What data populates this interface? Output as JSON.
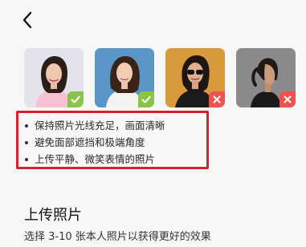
{
  "nav": {
    "back_icon": "chevron-left-icon"
  },
  "samples": [
    {
      "status": "good",
      "icon": "check-icon",
      "color": "#8bc34a"
    },
    {
      "status": "good",
      "icon": "check-icon",
      "color": "#8bc34a"
    },
    {
      "status": "bad",
      "icon": "close-icon",
      "color": "#ef5350"
    },
    {
      "status": "bad",
      "icon": "close-icon",
      "color": "#ef5350"
    }
  ],
  "tips": [
    "保持照片光线充足，画面清晰",
    "避免面部遮挡和极端角度",
    "上传平静、微笑表情的照片"
  ],
  "upload": {
    "title": "上传照片",
    "description": "选择 3-10 张本人照片以获得更好的效果"
  },
  "colors": {
    "highlight_border": "#d6212a",
    "background": "#f7f7f7"
  }
}
